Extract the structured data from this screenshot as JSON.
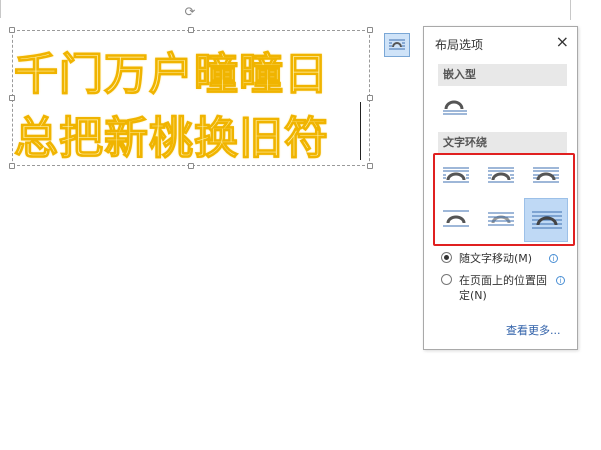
{
  "document": {
    "line1": "千门万户曈曈日",
    "line2": "总把新桃换旧符"
  },
  "panel": {
    "title": "布局选项",
    "close_symbol": "×",
    "inline_section": "嵌入型",
    "wrap_section": "文字环绕",
    "radio_move_with_text": "随文字移动(M)",
    "radio_fix_position": "在页面上的位置固定(N)",
    "see_more": "查看更多...",
    "selected_wrap_index": 5
  },
  "colors": {
    "wordart_fill": "#fff3b0",
    "wordart_outline": "#f0b400",
    "highlight_red": "#e02020",
    "selection_blue": "#bfd9f5"
  }
}
